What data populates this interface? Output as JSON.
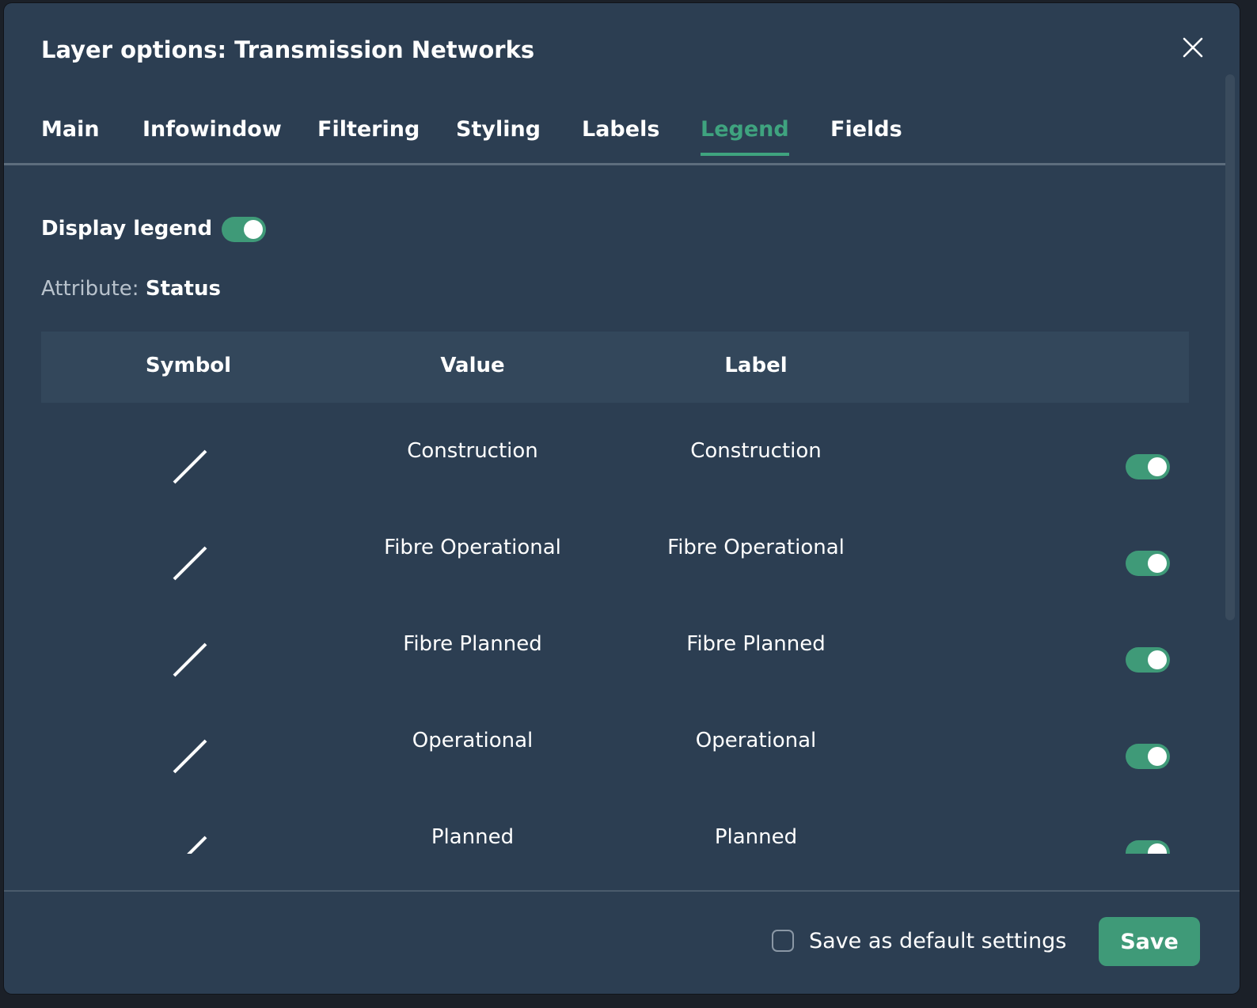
{
  "dialog": {
    "title": "Layer options: Transmission Networks"
  },
  "tabs": [
    {
      "label": "Main",
      "active": false
    },
    {
      "label": "Infowindow",
      "active": false
    },
    {
      "label": "Filtering",
      "active": false
    },
    {
      "label": "Styling",
      "active": false
    },
    {
      "label": "Labels",
      "active": false
    },
    {
      "label": "Legend",
      "active": true
    },
    {
      "label": "Fields",
      "active": false
    }
  ],
  "legend": {
    "display_label": "Display legend",
    "display_enabled": true,
    "attribute_label": "Attribute:",
    "attribute_value": "Status"
  },
  "table": {
    "headers": {
      "symbol": "Symbol",
      "value": "Value",
      "label": "Label"
    },
    "rows": [
      {
        "value": "Construction",
        "label": "Construction",
        "visible": true,
        "symbol_icon": "line-symbol-icon"
      },
      {
        "value": "Fibre Operational",
        "label": "Fibre Operational",
        "visible": true,
        "symbol_icon": "line-symbol-icon"
      },
      {
        "value": "Fibre Planned",
        "label": "Fibre Planned",
        "visible": true,
        "symbol_icon": "line-symbol-icon"
      },
      {
        "value": "Operational",
        "label": "Operational",
        "visible": true,
        "symbol_icon": "line-symbol-icon"
      },
      {
        "value": "Planned",
        "label": "Planned",
        "visible": true,
        "symbol_icon": "line-symbol-icon"
      }
    ]
  },
  "footer": {
    "default_checkbox_label": "Save as default settings",
    "default_checked": false,
    "save_label": "Save"
  },
  "colors": {
    "dialog_bg": "#2c3e52",
    "header_bg": "#33475b",
    "accent": "#3f9a78",
    "active_tab": "#3fa37f"
  }
}
